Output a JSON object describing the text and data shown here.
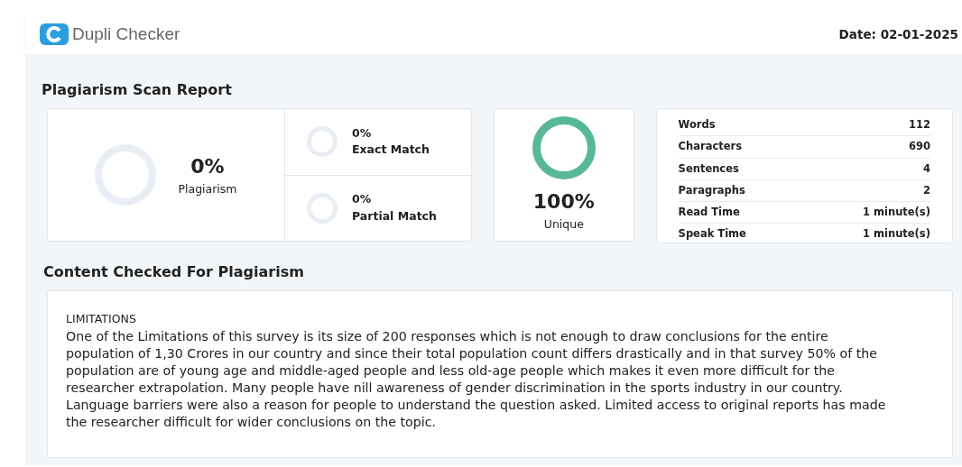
{
  "header": {
    "logo_text": "Dupli Checker",
    "date": "Date: 02-01-2025"
  },
  "report": {
    "title": "Plagiarism Scan Report",
    "plagiarism": {
      "value": "0%",
      "label": "Plagiarism"
    },
    "matches": [
      {
        "value": "0%",
        "label": "Exact Match"
      },
      {
        "value": "0%",
        "label": "Partial Match"
      }
    ],
    "unique": {
      "value": "100%",
      "label": "Unique"
    },
    "stats": [
      {
        "label": "Words",
        "value": "112"
      },
      {
        "label": "Characters",
        "value": "690"
      },
      {
        "label": "Sentences",
        "value": "4"
      },
      {
        "label": "Paragraphs",
        "value": "2"
      },
      {
        "label": "Read Time",
        "value": "1 minute(s)"
      },
      {
        "label": "Speak Time",
        "value": "1 minute(s)"
      }
    ]
  },
  "content": {
    "title": "Content Checked For Plagiarism",
    "heading": "LIMITATIONS",
    "text": "One of the Limitations of this survey is its size of 200 responses which is not enough to draw conclusions for the entire population of 1,30 Crores in our country and since their total population count differs drastically and in that survey 50% of the population are of young age and middle-aged people and less old-age people which makes it even more difficult for the researcher extrapolation. Many people have nill awareness of gender discrimination in the sports industry in our country. Language barriers were also a reason for people to understand the question asked. Limited access to original reports has made the researcher difficult for wider conclusions on the topic."
  }
}
